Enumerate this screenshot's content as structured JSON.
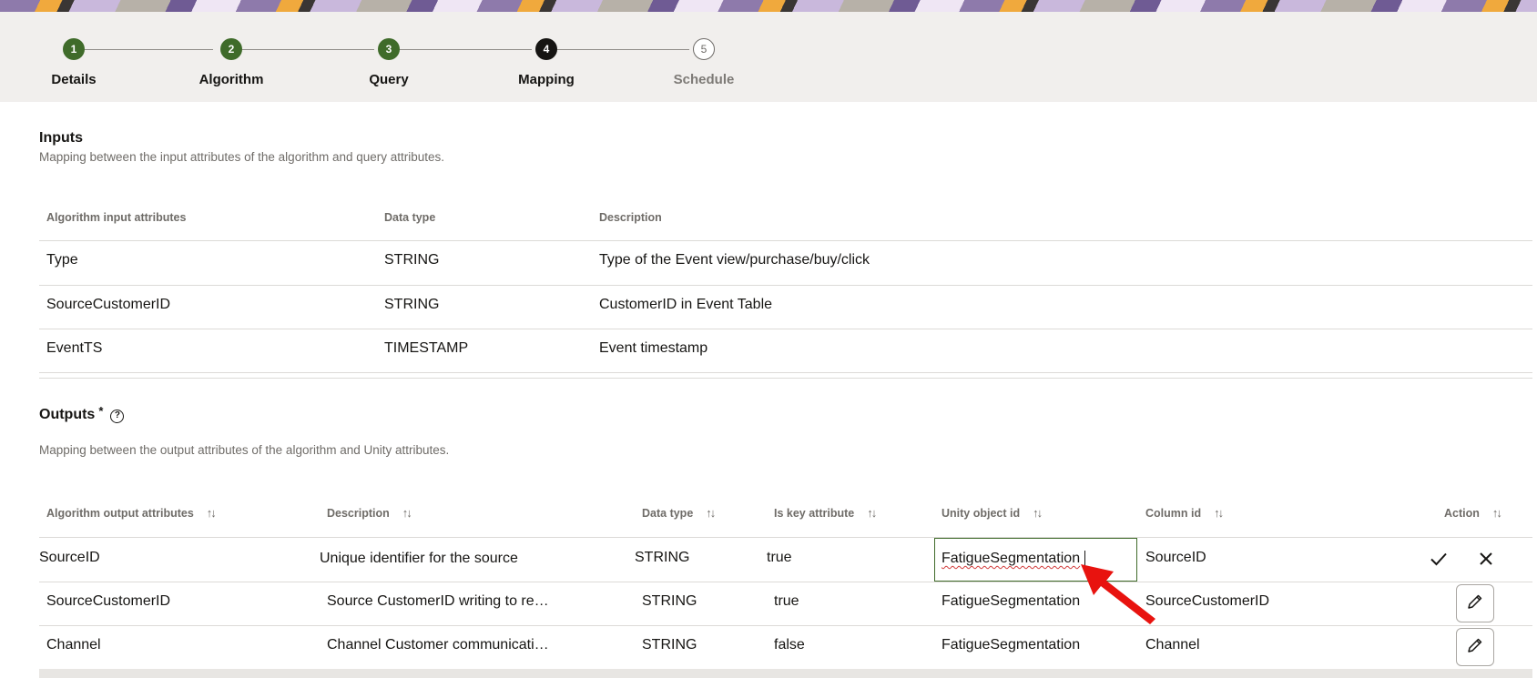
{
  "stepper": {
    "steps": [
      {
        "number": "1",
        "label": "Details",
        "state": "done"
      },
      {
        "number": "2",
        "label": "Algorithm",
        "state": "done"
      },
      {
        "number": "3",
        "label": "Query",
        "state": "done"
      },
      {
        "number": "4",
        "label": "Mapping",
        "state": "current"
      },
      {
        "number": "5",
        "label": "Schedule",
        "state": "todo"
      }
    ]
  },
  "inputs": {
    "title": "Inputs",
    "description": "Mapping between the input attributes of the algorithm and query attributes.",
    "columns": [
      "Algorithm input attributes",
      "Data type",
      "Description"
    ],
    "rows": [
      [
        "Type",
        "STRING",
        "Type of the Event view/purchase/buy/click"
      ],
      [
        "SourceCustomerID",
        "STRING",
        "CustomerID in Event Table"
      ],
      [
        "EventTS",
        "TIMESTAMP",
        "Event timestamp"
      ]
    ]
  },
  "outputs": {
    "title": "Outputs",
    "required_marker": "*",
    "help_icon": "?",
    "description": "Mapping between the output attributes of the algorithm and Unity attributes.",
    "columns": [
      "Algorithm output attributes",
      "Description",
      "Data type",
      "Is key attribute",
      "Unity object id",
      "Column id",
      "Action"
    ],
    "sort_icon": "↑↓",
    "rows": [
      {
        "attribute": "SourceID",
        "description": "Unique identifier for the source",
        "data_type": "STRING",
        "is_key": "true",
        "unity_object_id": "FatigueSegmentation",
        "column_id": "SourceID",
        "editing": true
      },
      {
        "attribute": "SourceCustomerID",
        "description": "Source CustomerID writing to re…",
        "data_type": "STRING",
        "is_key": "true",
        "unity_object_id": "FatigueSegmentation",
        "column_id": "SourceCustomerID",
        "editing": false
      },
      {
        "attribute": "Channel",
        "description": "Channel Customer communicati…",
        "data_type": "STRING",
        "is_key": "false",
        "unity_object_id": "FatigueSegmentation",
        "column_id": "Channel",
        "editing": false
      }
    ]
  },
  "icons": {
    "check": "check-icon",
    "close": "close-icon",
    "edit": "pencil-icon",
    "annotation_arrow_color": "#e8130f"
  }
}
